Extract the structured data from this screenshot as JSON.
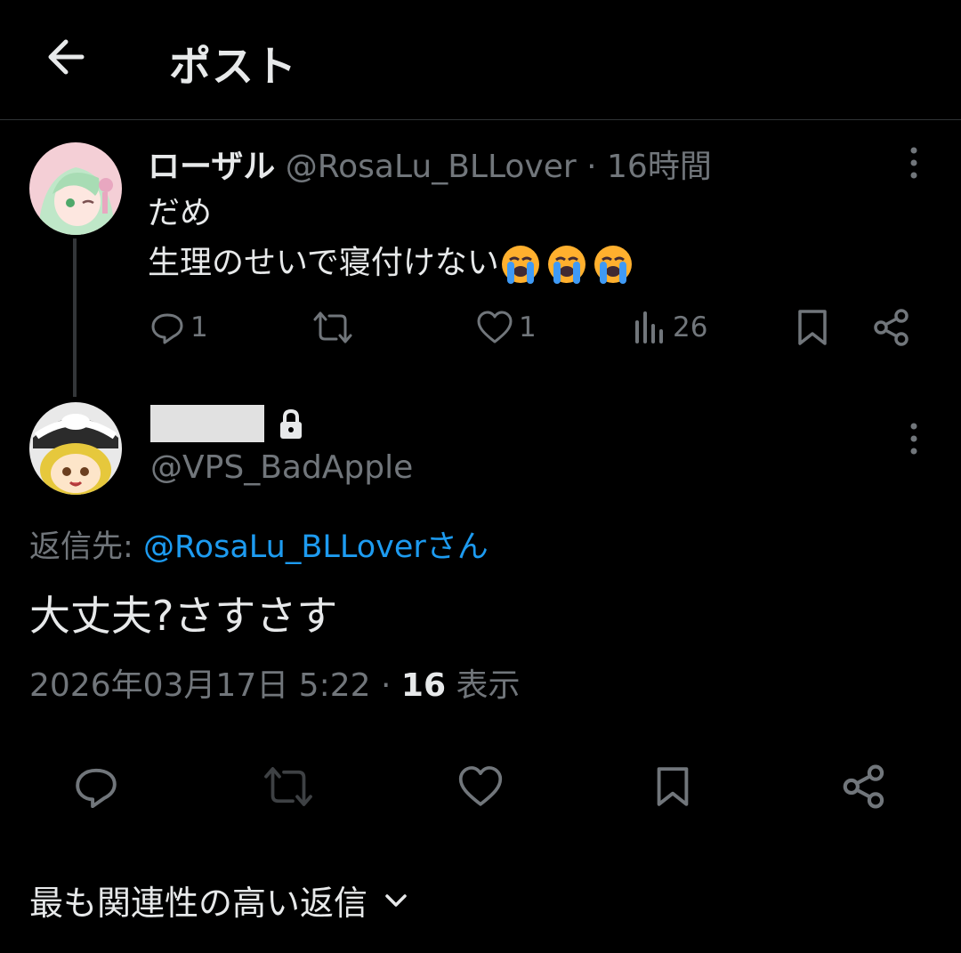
{
  "header": {
    "title": "ポスト"
  },
  "tweet1": {
    "name": "ローザル",
    "handle": "@RosaLu_BLLover",
    "separator": "·",
    "time": "16時間",
    "text_line1": "だめ",
    "text_line2": "生理のせいで寝付けない",
    "emoji": [
      "loudly-crying-face",
      "loudly-crying-face",
      "loudly-crying-face"
    ],
    "actions": {
      "replies": "1",
      "likes": "1",
      "views": "26"
    }
  },
  "tweet2": {
    "handle": "@VPS_BadApple",
    "reply_to_label": "返信先:",
    "reply_to_mention": "@RosaLu_BLLoverさん",
    "text": "大丈夫?さすさす",
    "timestamp": "2026年03月17日 5:22",
    "separator": "·",
    "views_count": "16",
    "views_label": "表示"
  },
  "sort": {
    "label": "最も関連性の高い返信"
  },
  "colors": {
    "background": "#000000",
    "text": "#e7e9ea",
    "muted": "#71767b",
    "link": "#1d9bf0",
    "divider": "#2f3336"
  }
}
